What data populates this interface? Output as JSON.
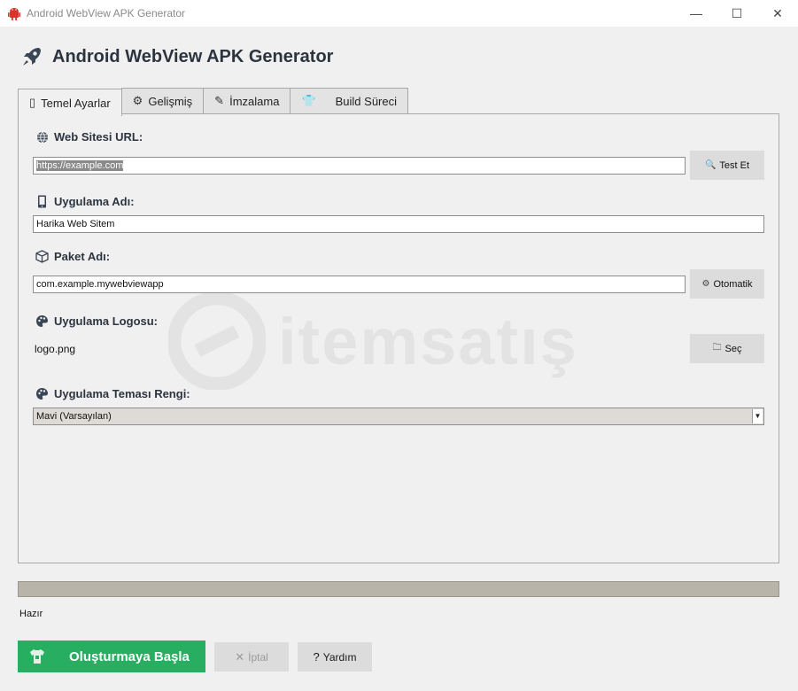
{
  "window": {
    "title": "Android WebView APK Generator",
    "controls": {
      "minimize": "—",
      "maximize": "☐",
      "close": "✕"
    }
  },
  "header": {
    "title": "Android WebView APK Generator",
    "icon": "rocket-icon"
  },
  "tabs": [
    {
      "label": "Temel Ayarlar",
      "icon": "phone-icon",
      "glyph": "▯",
      "active": true
    },
    {
      "label": "Gelişmiş",
      "icon": "gear-icon",
      "glyph": "⚙",
      "active": false
    },
    {
      "label": "İmzalama",
      "icon": "signature-icon",
      "glyph": "✎",
      "active": false
    },
    {
      "label": "Build Süreci",
      "icon": "shirt-icon",
      "glyph": "👕",
      "active": false
    }
  ],
  "form": {
    "url": {
      "label": "Web Sitesi URL:",
      "icon": "globe-icon",
      "value": "https://example.com",
      "button": "Test Et",
      "button_icon": "magnifier-icon"
    },
    "app_name": {
      "label": "Uygulama Adı:",
      "icon": "phone-icon",
      "value": "Harika Web Sitem"
    },
    "package": {
      "label": "Paket Adı:",
      "icon": "package-icon",
      "value": "com.example.mywebviewapp",
      "button": "Otomatik",
      "button_icon": "gear-icon"
    },
    "logo": {
      "label": "Uygulama Logosu:",
      "icon": "palette-icon",
      "value": "logo.png",
      "button": "Seç",
      "button_icon": "folder-icon"
    },
    "theme": {
      "label": "Uygulama Teması Rengi:",
      "icon": "palette-icon",
      "selected": "Mavi (Varsayılan)"
    }
  },
  "progress": {
    "fraction": 0
  },
  "status": {
    "text": "Hazır"
  },
  "actions": {
    "start": {
      "label": "Oluşturmaya Başla",
      "icon": "shirt-icon",
      "color": "#27ae60"
    },
    "cancel": {
      "label": "İptal",
      "icon": "x-icon",
      "glyph": "✕",
      "enabled": false
    },
    "help": {
      "label": "Yardım",
      "icon": "question-icon",
      "glyph": "?"
    }
  },
  "watermark": {
    "text": "itemsatış"
  }
}
